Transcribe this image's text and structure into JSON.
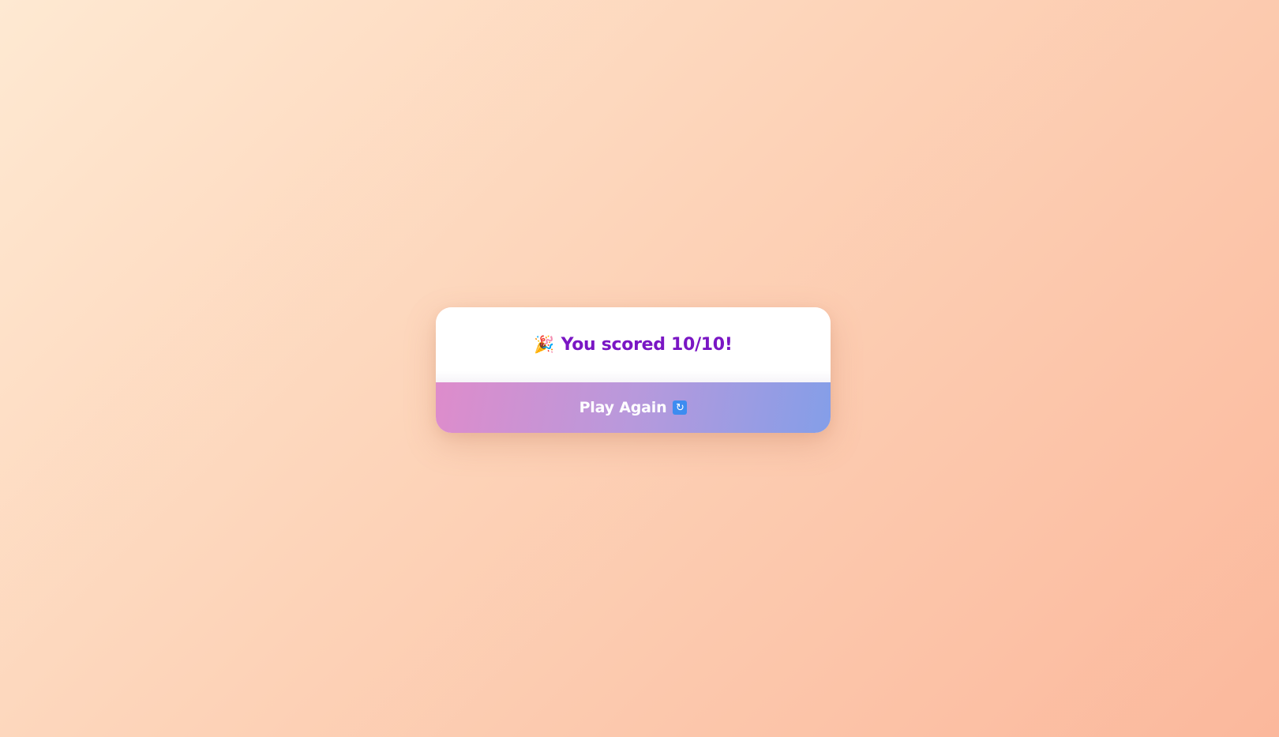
{
  "result": {
    "icon": "party-popper-icon",
    "icon_glyph": "🎉",
    "text": "You scored 10/10!"
  },
  "play_again": {
    "label": "Play Again",
    "icon": "refresh-icon",
    "icon_glyph": "🔄"
  },
  "colors": {
    "background_start": "#fee9d2",
    "background_end": "#fbb89c",
    "score_text": "#7a16c4",
    "button_gradient_start": "#de8ccb",
    "button_gradient_end": "#849ee8",
    "button_text": "#ffffff"
  }
}
